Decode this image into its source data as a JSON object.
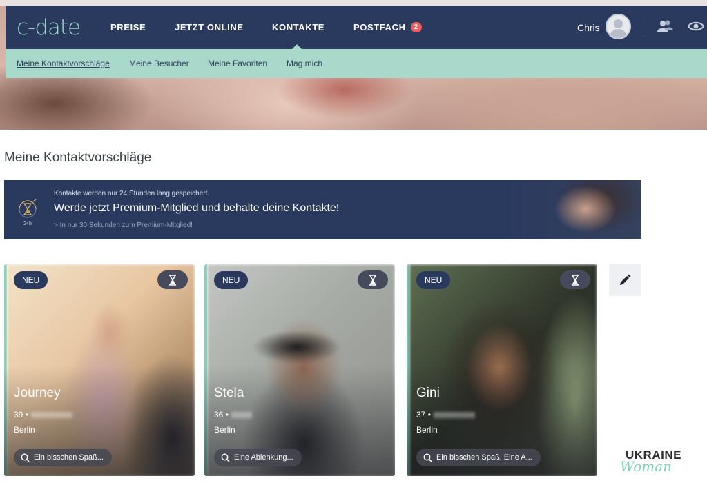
{
  "header": {
    "logo": "c-date",
    "nav": [
      {
        "label": "PREISE"
      },
      {
        "label": "JETZT ONLINE"
      },
      {
        "label": "KONTAKTE"
      },
      {
        "label": "POSTFACH",
        "badge": "2"
      }
    ],
    "user_name": "Chris"
  },
  "subnav": {
    "items": [
      {
        "label": "Meine Kontaktvorschläge",
        "active": true
      },
      {
        "label": "Meine Besucher"
      },
      {
        "label": "Meine Favoriten"
      },
      {
        "label": "Mag mich"
      }
    ]
  },
  "page": {
    "title": "Meine Kontaktvorschläge"
  },
  "banner": {
    "icon_label": "24h",
    "small_text": "Kontakte werden nur 24 Stunden lang gespeichert.",
    "headline": "Werde jetzt Premium-Mitglied und behalte deine Kontakte!",
    "link_text": "> In nur 30 Sekunden zum Premium-Mitglied!"
  },
  "cards": [
    {
      "badge": "NEU",
      "name": "Journey",
      "age": "39",
      "city": "Berlin",
      "looking_for": "Ein bisschen Spaß..."
    },
    {
      "badge": "NEU",
      "name": "Stela",
      "age": "36",
      "city": "Berlin",
      "looking_for": "Eine Ablenkung..."
    },
    {
      "badge": "NEU",
      "name": "Gini",
      "age": "37",
      "city": "Berlin",
      "looking_for": "Ein bisschen Spaß, Eine A..."
    }
  ],
  "watermark": {
    "line1": "UKRAINE",
    "line2": "Woman"
  },
  "colors": {
    "nav_bg": "#2a3a5f",
    "subnav_bg": "#a9d9cb",
    "logo": "#9ed8c9",
    "badge": "#ef5b5b",
    "card_accent": "#7fd1bd"
  }
}
